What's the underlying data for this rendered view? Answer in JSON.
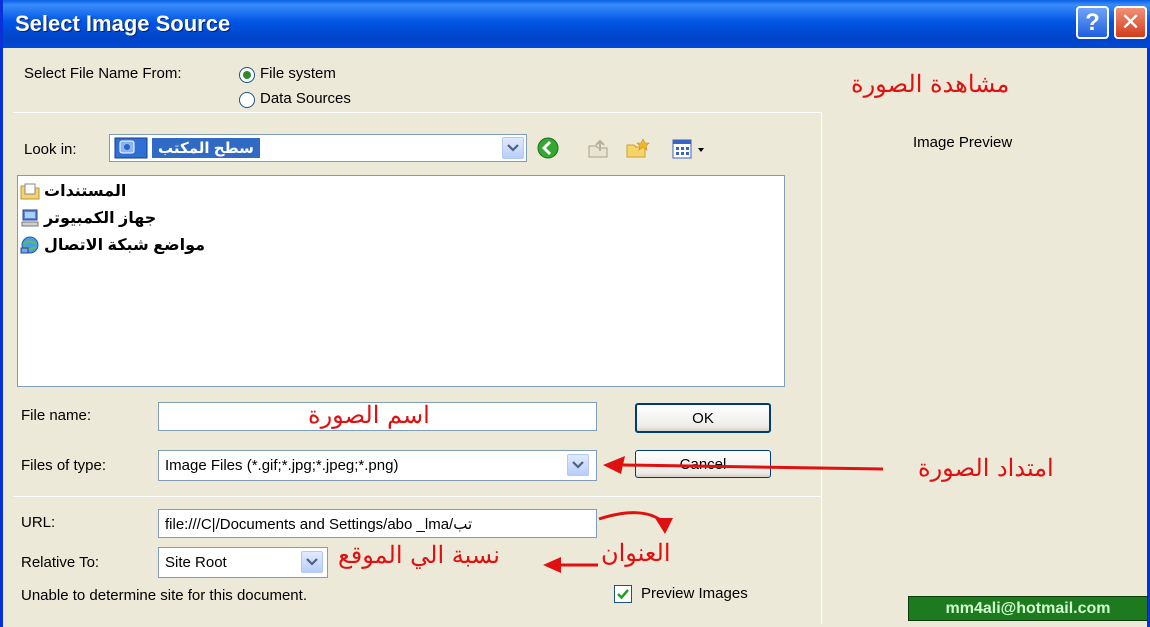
{
  "window": {
    "title": "Select Image Source",
    "help": "?",
    "close": "✕"
  },
  "source": {
    "label": "Select File Name From:",
    "option_file_system": "File system",
    "option_data_sources": "Data Sources",
    "selected": "File system"
  },
  "look_in": {
    "label": "Look in:",
    "value": "سطح المكتب"
  },
  "list": {
    "items": [
      "المستندات",
      "جهاز الكمبيوتر",
      "مواضع شبكة الاتصال"
    ]
  },
  "file_name": {
    "label": "File name:",
    "value": ""
  },
  "files_of_type": {
    "label": "Files of type:",
    "value": "Image Files (*.gif;*.jpg;*.jpeg;*.png)"
  },
  "buttons": {
    "ok": "OK",
    "cancel": "Cancel"
  },
  "url": {
    "label": "URL:",
    "value": "file:///C|/Documents and Settings/abo _lma/تب"
  },
  "relative_to": {
    "label": "Relative To:",
    "value": "Site Root"
  },
  "status": {
    "message": "Unable to determine site for this document."
  },
  "preview_images": {
    "label": "Preview Images",
    "checked": true
  },
  "preview": {
    "label": "Image Preview"
  },
  "annotations": {
    "image_preview": "مشاهدة الصورة",
    "image_name": "اسم الصورة",
    "image_extension": "امتداد الصورة",
    "address": "العنوان",
    "relative_to_site": "نسبة الي الموقع"
  },
  "watermark": "mm4ali@hotmail.com",
  "colors": {
    "titlebar": "#0055E5",
    "dialog_bg": "#ECE9D8",
    "annotation": "#E01010",
    "watermark_bg": "#1E7A1E"
  }
}
